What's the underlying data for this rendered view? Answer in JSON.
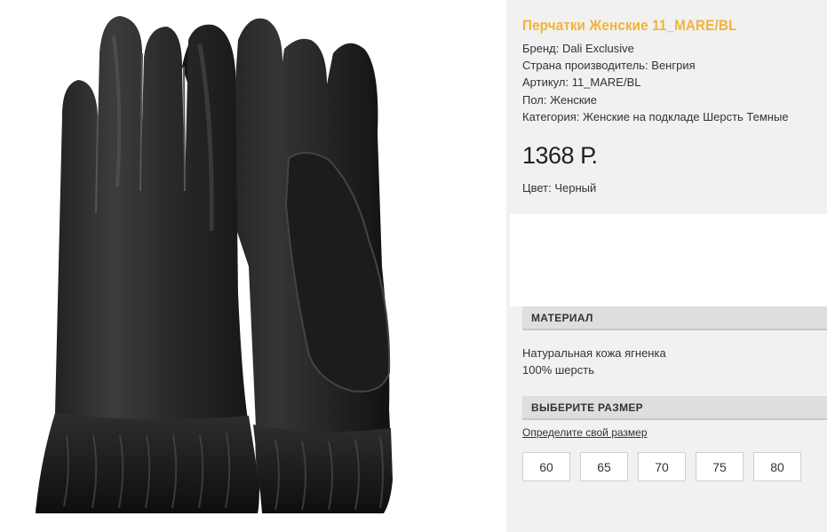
{
  "product": {
    "title": "Перчатки Женские 11_MARE/BL",
    "specs": [
      "Бренд: Dali Exclusive",
      "Страна производитель: Венгрия",
      "Артикул: 11_MARE/BL",
      "Пол: Женские",
      "Категория: Женские на подкладе Шерсть Темные"
    ],
    "price": "1368 Р.",
    "color": "Цвет: Черный",
    "image_icon": "leather-gloves-photo"
  },
  "material": {
    "header": "МАТЕРИАЛ",
    "lines": [
      "Натуральная кожа ягненка",
      "100% шерсть"
    ]
  },
  "size": {
    "header": "ВЫБЕРИТЕ РАЗМЕР",
    "link": "Определите свой размер",
    "options": [
      "60",
      "65",
      "70",
      "75",
      "80"
    ]
  },
  "colors": {
    "title_accent": "#f0b43c",
    "panel_bg": "#f1f1f1",
    "header_bg": "#dedede"
  }
}
